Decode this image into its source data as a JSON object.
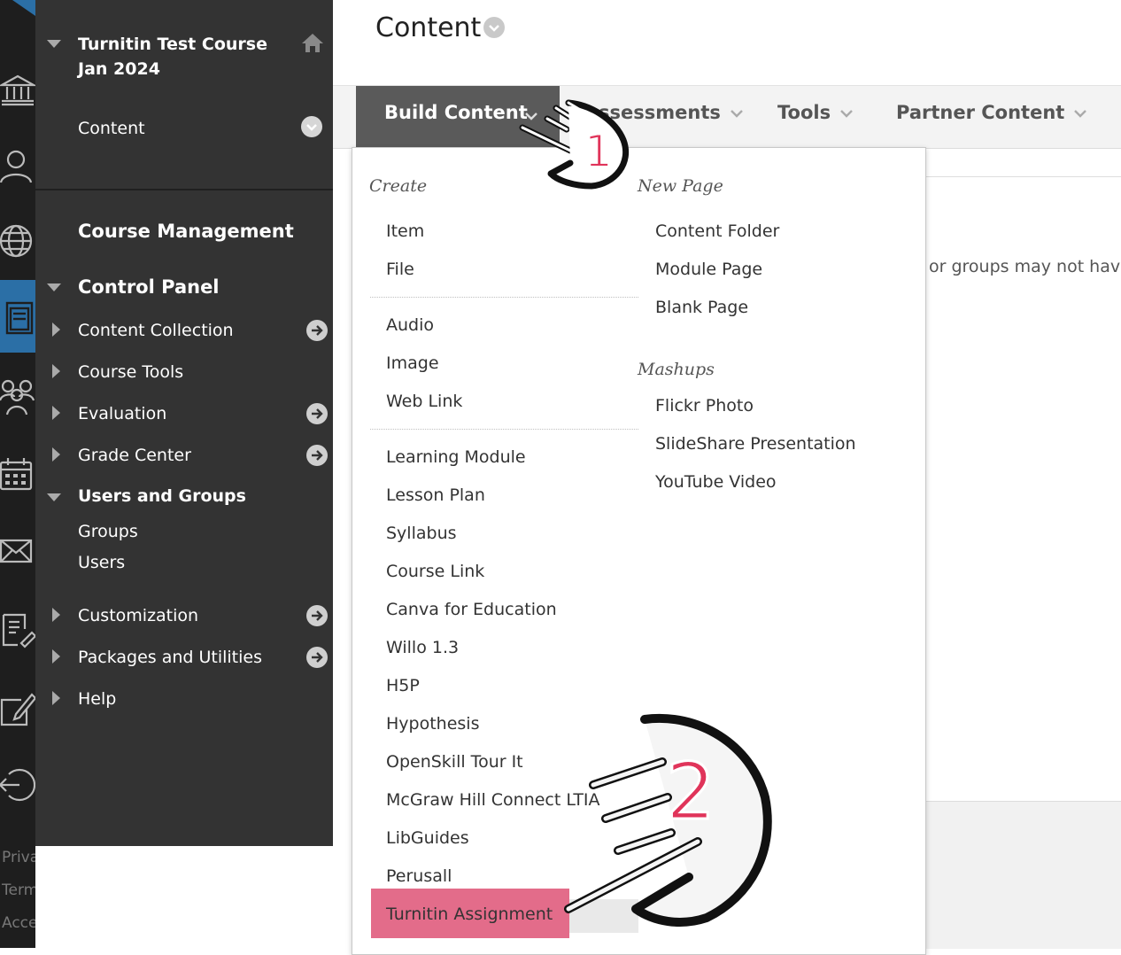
{
  "rail": {
    "icons": [
      "institution-icon",
      "profile-icon",
      "globe-icon",
      "courses-icon",
      "groups-icon",
      "calendar-icon",
      "messages-icon",
      "grades-icon",
      "tools-edit-icon",
      "sign-out-icon"
    ],
    "footer": [
      "Priva",
      "Term",
      "Acce"
    ],
    "active_color": "#2b6fa6"
  },
  "course_menu": {
    "course_title": "Turnitin Test Course Jan 2024",
    "content_link": "Content",
    "course_management": "Course Management",
    "control_panel": "Control Panel",
    "items": [
      "Content Collection",
      "Course Tools",
      "Evaluation",
      "Grade Center",
      "Users and Groups",
      "Groups",
      "Users",
      "Customization",
      "Packages and Utilities",
      "Help"
    ]
  },
  "main": {
    "page_title": "Content",
    "background_text": "or groups may not hav"
  },
  "toolbar": {
    "build_content": "Build Content",
    "assessments": "ssessments",
    "tools": "Tools",
    "partner_content": "Partner Content"
  },
  "dropdown": {
    "create_heading": "Create",
    "create_group1": [
      "Item",
      "File"
    ],
    "create_group2": [
      "Audio",
      "Image",
      "Web Link"
    ],
    "create_group3": [
      "Learning Module",
      "Lesson Plan",
      "Syllabus",
      "Course Link",
      "Canva for Education",
      "Willo 1.3",
      "H5P",
      "Hypothesis",
      "OpenSkill Tour It",
      "McGraw Hill Connect LTIA",
      "LibGuides",
      "Perusall",
      "Turnitin Assignment"
    ],
    "new_page_heading": "New Page",
    "new_page_items": [
      "Content Folder",
      "Module Page",
      "Blank Page"
    ],
    "mashups_heading": "Mashups",
    "mashups_items": [
      "Flickr Photo",
      "SlideShare Presentation",
      "YouTube Video"
    ]
  },
  "annotations": {
    "step1": "1",
    "step2": "2",
    "step_color": "#e0345a",
    "highlight_color": "#e36c8a"
  }
}
